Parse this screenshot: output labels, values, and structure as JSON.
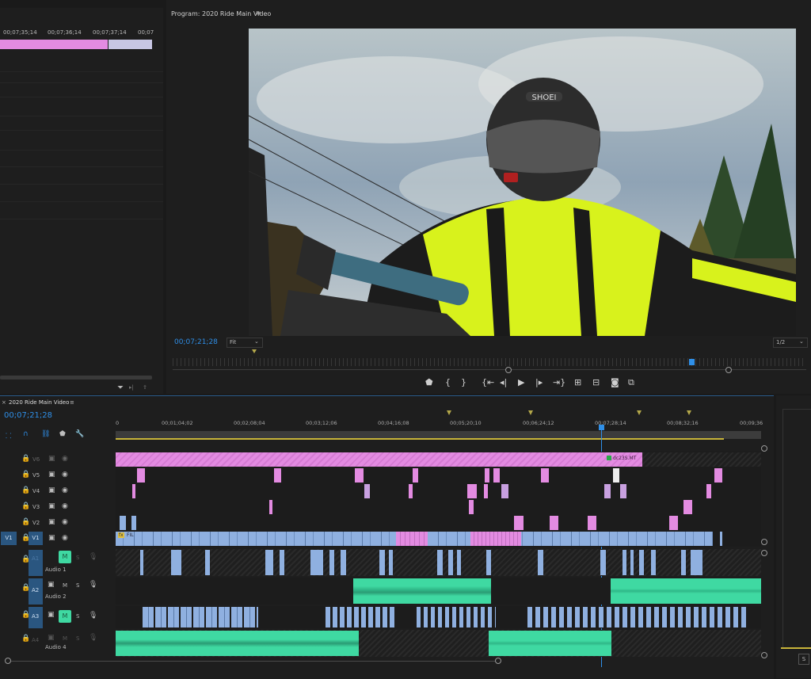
{
  "source_panel": {
    "ruler_times": [
      "00;07;35;14",
      "00;07;36;14",
      "00;07;37;14",
      "00;07"
    ]
  },
  "program": {
    "title": "Program: 2020 Ride Main Video",
    "menu_icon": "≡",
    "timecode": "00;07;21;28",
    "zoom_value": "Fit",
    "resolution_value": "1/2",
    "helmet_brand": "SHOEI"
  },
  "timeline": {
    "tab_title": "2020 Ride Main Video",
    "tab_close": "×",
    "tab_menu": "≡",
    "timecode": "00;07;21;28",
    "ruler_times": [
      "0",
      "00;01;04;02",
      "00;02;08;04",
      "00;03;12;06",
      "00;04;16;08",
      "00;05;20;10",
      "00;06;24;12",
      "00;07;28;14",
      "00;08;32;16",
      "00;09;36"
    ],
    "tracks_video": [
      {
        "id": "V6",
        "label": "V6"
      },
      {
        "id": "V5",
        "label": "V5"
      },
      {
        "id": "V4",
        "label": "V4"
      },
      {
        "id": "V3",
        "label": "V3"
      },
      {
        "id": "V2",
        "label": "V2"
      },
      {
        "id": "V1",
        "label": "V1",
        "source": "V1"
      }
    ],
    "tracks_audio": [
      {
        "id": "A1",
        "name": "Audio 1",
        "m": "M",
        "s": "S"
      },
      {
        "id": "A2",
        "name": "Audio 2",
        "m": "M",
        "s": "S"
      },
      {
        "id": "A3",
        "name": "",
        "m": "M",
        "s": "S"
      },
      {
        "id": "A4",
        "name": "Audio 4",
        "m": "M",
        "s": "S"
      }
    ],
    "clip_labels": {
      "v6_marker": "dc23S.MT",
      "v1_first": "FIL"
    }
  },
  "right_panel": {
    "s_label": "S"
  },
  "colors": {
    "accent_blue": "#2f8fe8",
    "clip_pink": "#e38be1",
    "clip_blue": "#8fb0e0",
    "clip_green": "#3fd9a2"
  }
}
